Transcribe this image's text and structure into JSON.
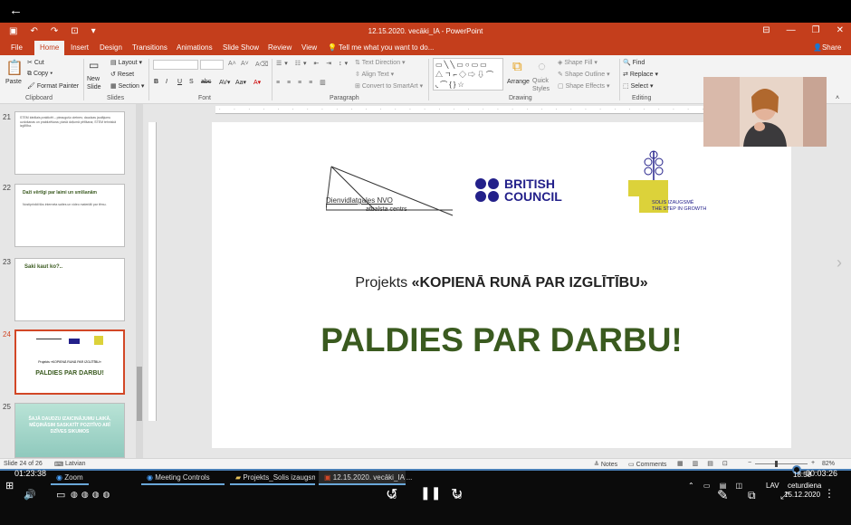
{
  "player": {
    "back_icon": "arrow-left-icon",
    "elapsed": "01:23:38",
    "remaining": "00:03:26",
    "rewind_label": "10",
    "forward_label": "30"
  },
  "window": {
    "title": "12.15.2020. vecāki_IA - PowerPoint"
  },
  "menu": {
    "tell_me": "Tell me what you want to do...",
    "share": "Share",
    "tabs": [
      "File",
      "Home",
      "Insert",
      "Design",
      "Transitions",
      "Animations",
      "Slide Show",
      "Review",
      "View"
    ]
  },
  "ribbon": {
    "clipboard": {
      "paste": "Paste",
      "cut": "Cut",
      "copy": "Copy",
      "format_painter": "Format Painter",
      "label": "Clipboard"
    },
    "slides": {
      "new_slide": "New Slide",
      "layout": "Layout",
      "reset": "Reset",
      "section": "Section",
      "label": "Slides"
    },
    "font": {
      "label": "Font",
      "bold": "B",
      "italic": "I",
      "underline": "U",
      "strike": "S",
      "shadow": "abc"
    },
    "paragraph": {
      "label": "Paragraph",
      "text_direction": "Text Direction",
      "align_text": "Align Text",
      "smartart": "Convert to SmartArt"
    },
    "drawing": {
      "label": "Drawing",
      "arrange": "Arrange",
      "quick_styles": "Quick Styles",
      "shape_fill": "Shape Fill",
      "shape_outline": "Shape Outline",
      "shape_effects": "Shape Effects"
    },
    "editing": {
      "label": "Editing",
      "find": "Find",
      "replace": "Replace",
      "select": "Select"
    }
  },
  "thumbnails": [
    {
      "num": "21",
      "text": "STEM ideālais prakticēt – pieaugušo cietnes; daudzas jautājumu uzdošanas un praktizēšana; plašā dziļumā pētīšana; STEM tehniskā izglītība."
    },
    {
      "num": "22",
      "title": "Daži vērtīgi par laimi un smīšanām",
      "text": "Nostiprināti tiks interneta saites un video materiāli par tēmu."
    },
    {
      "num": "23",
      "title": "Saki kaut ko?.."
    },
    {
      "num": "24",
      "title": "PALDIES PAR DARBU!",
      "subtitle": "Projekts «KOPIENĀ RUNĀ PAR IZGLĪTĪBU»"
    },
    {
      "num": "25",
      "text": "ŠAJĀ DAUDZU IZAICINĀJUMU LAIKĀ, MĒĢINĀSIM SASKATĪT POZITĪVO ARĪ DZĪVES SIKUMOS"
    }
  ],
  "slide": {
    "logo1_line1": "Dienvidlatgales NVO",
    "logo1_line2": "atbalsta centrs",
    "logo2_line1": "BRITISH",
    "logo2_line2": "COUNCIL",
    "logo3_line1": "SOLIS IZAUGSMĒ",
    "logo3_line2": "THE STEP IN GROWTH",
    "project_prefix": "Projekts",
    "project_name": "«KOPIENĀ RUNĀ PAR IZGLĪTĪBU»",
    "headline": "PALDIES PAR DARBU!"
  },
  "statusbar": {
    "slide_info": "Slide 24 of 26",
    "language": "Latvian",
    "notes": "Notes",
    "comments": "Comments",
    "zoom": "82%"
  },
  "taskbar": {
    "apps": [
      "Zoom",
      "Meeting Controls",
      "Projekts_Solis izaugsmē",
      "12.15.2020. vecāki_IA ..."
    ],
    "time": "18:58",
    "day": "ceturdiena",
    "date": "15.12.2020",
    "lang": "LAV"
  },
  "colors": {
    "accent": "#c43e1c",
    "headline": "#3a5a1f",
    "british_council": "#23208a"
  }
}
